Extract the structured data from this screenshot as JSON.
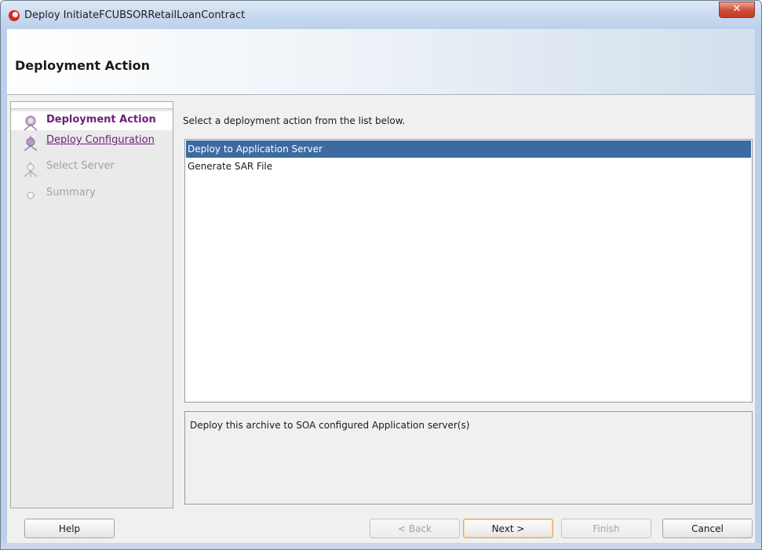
{
  "window": {
    "title": "Deploy InitiateFCUBSORRetailLoanContract",
    "close_glyph": "✕",
    "app_icon": "oracle-jdeveloper-icon"
  },
  "header": {
    "title": "Deployment Action"
  },
  "nav": {
    "items": [
      {
        "label": "Deployment Action",
        "state": "current"
      },
      {
        "label": "Deploy Configuration",
        "state": "visited"
      },
      {
        "label": "Select Server",
        "state": "disabled"
      },
      {
        "label": "Summary",
        "state": "disabled"
      }
    ]
  },
  "content": {
    "instruction": "Select a deployment action from the list below.",
    "actions": [
      {
        "label": "Deploy to Application Server",
        "selected": true
      },
      {
        "label": "Generate SAR File",
        "selected": false
      }
    ],
    "description": "Deploy this archive to SOA configured Application server(s)"
  },
  "buttons": {
    "help": "Help",
    "back": "< Back",
    "next": "Next >",
    "finish": "Finish",
    "cancel": "Cancel"
  },
  "colors": {
    "selection": "#3c6aa1",
    "nav_active": "#6d2077",
    "close_button": "#c8452f"
  }
}
